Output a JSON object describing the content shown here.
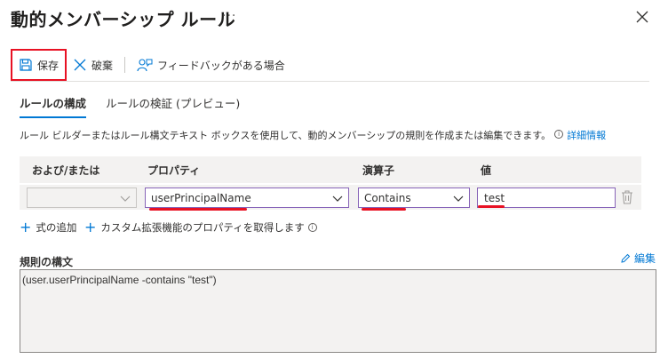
{
  "header": {
    "title": "動的メンバーシップ ルール",
    "more": "···"
  },
  "toolbar": {
    "save_label": "保存",
    "discard_label": "破棄",
    "feedback_label": "フィードバックがある場合"
  },
  "tabs": [
    {
      "label": "ルールの構成",
      "active": true
    },
    {
      "label": "ルールの検証 (プレビュー)",
      "active": false
    }
  ],
  "description": {
    "text": "ルール ビルダーまたはルール構文テキスト ボックスを使用して、動的メンバーシップの規則を作成または編集できます。",
    "info": "i",
    "link": "詳細情報"
  },
  "grid": {
    "columns": [
      "および/または",
      "プロパティ",
      "演算子",
      "値"
    ],
    "rows": [
      {
        "and_or": "",
        "property": "userPrincipalName",
        "operator": "Contains",
        "value": "test"
      }
    ]
  },
  "actions": {
    "add_expression": "式の追加",
    "get_custom_properties": "カスタム拡張機能のプロパティを取得します"
  },
  "rule_syntax": {
    "label": "規則の構文",
    "edit_label": "編集",
    "value": "(user.userPrincipalName -contains \"test\")"
  },
  "colors": {
    "accent": "#0078d4",
    "highlight": "#e81123",
    "input_border": "#8764b8"
  }
}
